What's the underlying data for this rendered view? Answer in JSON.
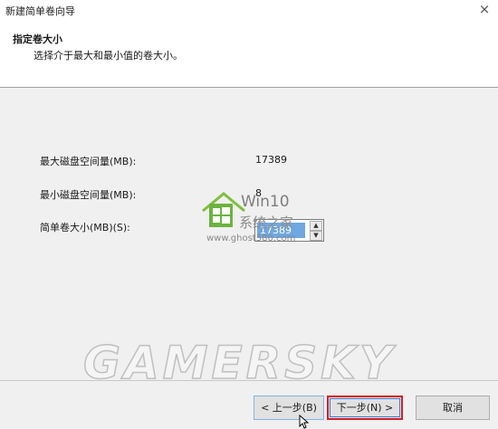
{
  "window": {
    "title": "新建简单卷向导",
    "close_glyph": "×"
  },
  "header": {
    "heading": "指定卷大小",
    "description": "选择介于最大和最小值的卷大小。"
  },
  "fields": [
    {
      "label": "最大磁盘空间量(MB):",
      "value": "17389"
    },
    {
      "label": "最小磁盘空间量(MB):",
      "value": "8"
    },
    {
      "label": "简单卷大小(MB)(S):",
      "value": "17389"
    }
  ],
  "watermark": {
    "site_title": "Win10",
    "site_subtitle": "系统之家",
    "site_url": "www.ghost580.com",
    "overlay_text": "GAMERSKY"
  },
  "buttons": {
    "back": "< 上一步(B)",
    "next": "下一步(N) >",
    "cancel": "取消"
  },
  "colors": {
    "highlight_border": "#d0202a",
    "focus_blue": "#3c7fd1",
    "selection": "#6fa7e0"
  }
}
